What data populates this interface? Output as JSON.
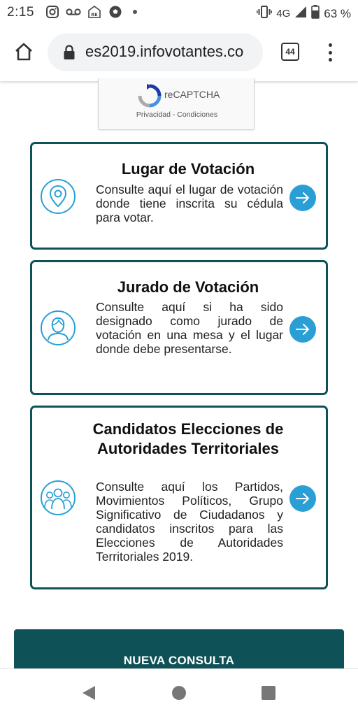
{
  "status_bar": {
    "time": "2:15",
    "left_icons": [
      "instagram-icon",
      "voicemail-icon",
      "calendar-re-icon",
      "soccer-icon",
      "dot-icon"
    ],
    "network": "4G",
    "battery": "63 %"
  },
  "browser": {
    "url": "es2019.infovotantes.co",
    "tab_count": "44"
  },
  "recaptcha": {
    "label": "reCAPTCHA",
    "links": "Privacidad - Condiciones"
  },
  "cards": [
    {
      "title": "Lugar de Votación",
      "description": "Consulte aquí el lugar de votación donde tiene inscrita su cédula para votar.",
      "icon": "location-pin-icon"
    },
    {
      "title": "Jurado de Votación",
      "description": "Consulte aquí si ha sido designado como jurado de votación en una mesa y el lugar donde debe presentarse.",
      "icon": "person-icon"
    },
    {
      "title": "Candidatos Elecciones de Autoridades Territoriales",
      "description": "Consulte aquí los Partidos, Movimientos Políticos, Grupo Significativo de Ciudadanos y candidatos inscritos para las Elecciones de Autoridades Territoriales 2019.",
      "icon": "group-icon"
    }
  ],
  "nueva_consulta_label": "NUEVA CONSULTA",
  "colors": {
    "card_border": "#0e5157",
    "accent_blue": "#2a9fd6",
    "button_bg": "#0e5157"
  }
}
